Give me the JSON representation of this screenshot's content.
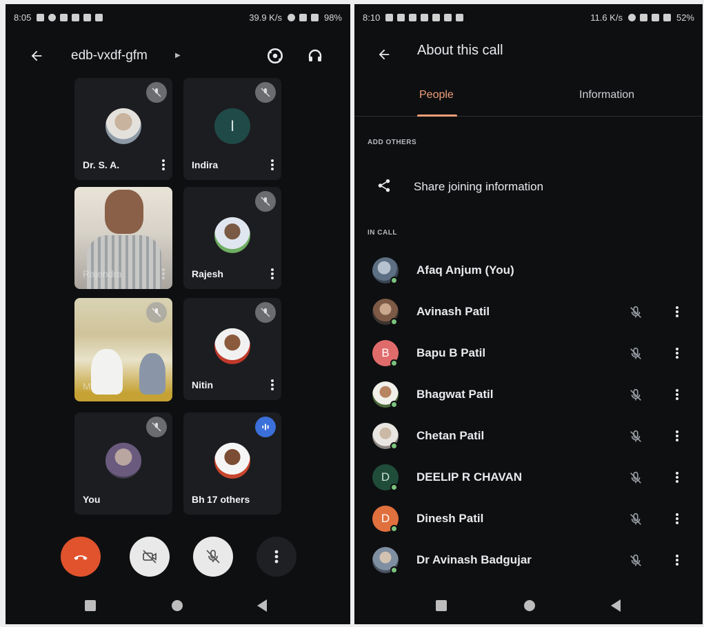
{
  "left_screen": {
    "status": {
      "time": "8:05",
      "speed": "39.9 K/s",
      "battery": "98%"
    },
    "meeting_code": "edb-vxdf-gfm",
    "tiles": [
      {
        "name": "Dr. S. A."
      },
      {
        "name": "Indira",
        "initial": "I"
      },
      {
        "name": "Rajendra"
      },
      {
        "name": "Rajesh"
      },
      {
        "name": "Mahesh"
      },
      {
        "name": "Nitin"
      },
      {
        "name": "You"
      },
      {
        "name": "Bh",
        "others": "17 others"
      }
    ]
  },
  "right_screen": {
    "status": {
      "time": "8:10",
      "speed": "11.6 K/s",
      "battery": "52%"
    },
    "title": "About this call",
    "tabs": [
      {
        "label": "People",
        "active": true
      },
      {
        "label": "Information",
        "active": false
      }
    ],
    "add_others_label": "ADD OTHERS",
    "share_label": "Share joining information",
    "in_call_label": "IN CALL",
    "participants": [
      {
        "name": "Afaq Anjum (You)",
        "avatar": "photo",
        "muted": false,
        "color": "#6b7a8c"
      },
      {
        "name": "Avinash Patil",
        "avatar": "photo",
        "muted": true,
        "color": "#8a6a54"
      },
      {
        "name": "Bapu B Patil",
        "avatar": "letter",
        "initial": "B",
        "muted": true,
        "color": "#e06b6b"
      },
      {
        "name": "Bhagwat Patil",
        "avatar": "photo",
        "muted": true,
        "color": "#9a7a62"
      },
      {
        "name": "Chetan Patil",
        "avatar": "photo",
        "muted": true,
        "color": "#a7a29c"
      },
      {
        "name": "DEELIP R CHAVAN",
        "avatar": "letter",
        "initial": "D",
        "muted": true,
        "color": "#1f4d3a"
      },
      {
        "name": "Dinesh Patil",
        "avatar": "letter",
        "initial": "D",
        "muted": true,
        "color": "#e0703d"
      },
      {
        "name": "Dr Avinash Badgujar",
        "avatar": "photo",
        "muted": true,
        "color": "#8b96a3"
      }
    ]
  }
}
